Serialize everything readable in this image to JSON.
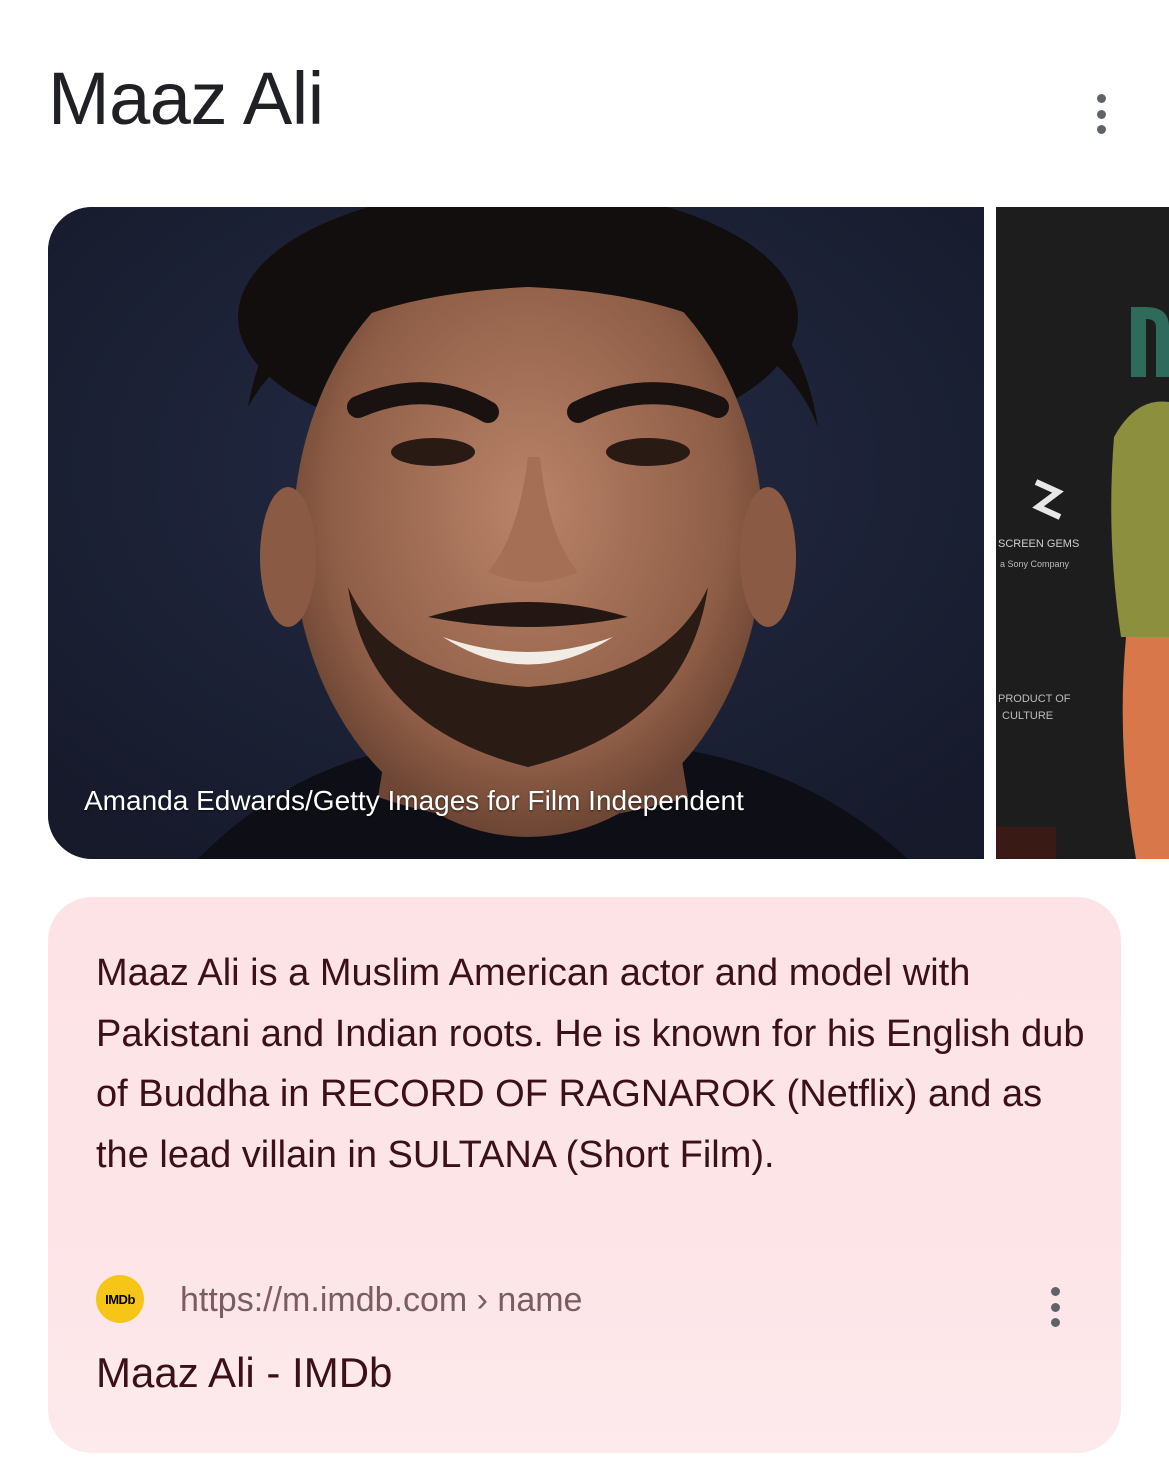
{
  "header": {
    "title": "Maaz Ali",
    "menu_icon": "more-vert-icon"
  },
  "images": {
    "main_credit": "Amanda Edwards/Getty Images for Film Independent",
    "second_backdrop_text_1": "SCREEN GEMS",
    "second_backdrop_text_2": "a Sony Company",
    "second_backdrop_text_3": "PRODUCT OF",
    "second_backdrop_text_4": "CULTURE"
  },
  "description": {
    "text": "Maaz Ali is a Muslim American actor and model with Pakistani and Indian roots. He is known for his English dub of Buddha in RECORD OF RAGNAROK (Netflix) and as the lead villain in SULTANA (Short Film).",
    "source_badge": "IMDb",
    "source_url": "https://m.imdb.com › name",
    "result_title": "Maaz Ali - IMDb",
    "menu_icon": "more-vert-icon"
  },
  "colors": {
    "card_bg": "#fde3e6",
    "text_dark": "#3c1018",
    "imdb_yellow": "#f5c518"
  }
}
